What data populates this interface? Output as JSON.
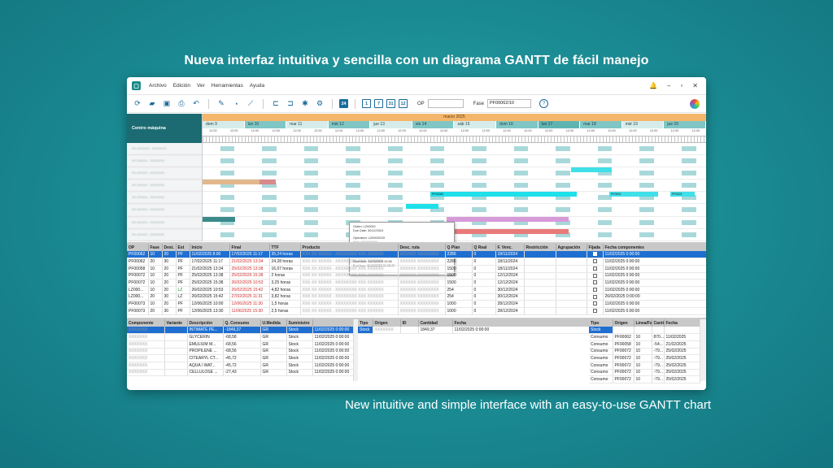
{
  "headline": "Nueva interfaz intuitiva y sencilla  con un diagrama GANTT de fácil manejo",
  "footline": "New intuitive and simple interface with an easy-to-use GANTT chart",
  "menu": [
    "Archivo",
    "Edición",
    "Ver",
    "Herramientas",
    "Ayuda"
  ],
  "toolbar": {
    "zoom_buttons": [
      "24",
      "1",
      "7",
      "31",
      "12"
    ],
    "op_label": "OP",
    "op_value": "",
    "fase_label": "Fase",
    "fase_value": "PF00062/10"
  },
  "gantt": {
    "side_header": "Centro máquina",
    "month": "marzo 2025",
    "days": [
      "dom 9",
      "lun 10",
      "mar 11",
      "mié 12",
      "jue 13",
      "vie 14",
      "sáb 15",
      "dom 16",
      "lun 17",
      "mar 18",
      "mié 19",
      "jue 20"
    ],
    "hour_label": "12:00",
    "popup": {
      "order": "Orden: LZ00020",
      "due": "Due Date: 30/12/2024",
      "op": "Operation: LZ00020/20",
      "qty": "Qty. Plan: 254",
      "datos": "Datos datos",
      "start": "Start time:   11/03/2025 12:08",
      "end": "End time:     11/03/2025 11:03:00"
    },
    "bar_labels": [
      "PF00062",
      "PF0003",
      "PF0003"
    ]
  },
  "main_table": {
    "columns": [
      "OP",
      "Fase",
      "Dest.",
      "Est",
      "Inicio",
      "Final",
      "TTF",
      "Producto",
      "Desc. ruta",
      "Q Plan",
      "Q Real",
      "F. Venc.",
      "Restricción",
      "Agrupación",
      "Fijada",
      "Fecha componentes"
    ],
    "rows": [
      {
        "op": "PF00062",
        "fase": "10",
        "dest": "20",
        "est": "PF",
        "inicio": "11/02/2025 8:00",
        "final": "17/02/2025 11:17",
        "ttf": "35,24 horas",
        "qplan": "2286",
        "qreal": "0",
        "fvenc": "18/11/2024",
        "fecha": "11/02/2025 0:00:00",
        "sel": true
      },
      {
        "op": "PF00062",
        "fase": "20",
        "dest": "30",
        "est": "PF",
        "inicio": "17/02/2025 11:17",
        "final": "21/02/2025 13:34",
        "ttf": "24,28 horas",
        "qplan": "2286",
        "qreal": "0",
        "fvenc": "18/11/2024",
        "fecha": "11/02/2025 0:00:00",
        "red": true
      },
      {
        "op": "PF00058",
        "fase": "10",
        "dest": "20",
        "est": "PF",
        "inicio": "21/02/2025 13:34",
        "final": "25/02/2025 13:38",
        "ttf": "16,07 horas",
        "qplan": "1500",
        "qreal": "0",
        "fvenc": "18/11/2024",
        "fecha": "11/02/2025 0:00:00",
        "red": true
      },
      {
        "op": "PF00072",
        "fase": "10",
        "dest": "20",
        "est": "PF",
        "inicio": "25/02/2025 13:38",
        "final": "25/02/2025 15:38",
        "ttf": "2 horas",
        "qplan": "1500",
        "qreal": "0",
        "fvenc": "12/12/2024",
        "fecha": "11/02/2025 0:00:00",
        "red": true
      },
      {
        "op": "PF00072",
        "fase": "10",
        "dest": "20",
        "est": "PF",
        "inicio": "25/02/2025 15:38",
        "final": "26/02/2025 10:53",
        "ttf": "3,25 horas",
        "qplan": "1500",
        "qreal": "0",
        "fvenc": "12/12/2024",
        "fecha": "11/02/2025 0:00:00",
        "red": true
      },
      {
        "op": "LZ000...",
        "fase": "10",
        "dest": "20",
        "est": "LZ",
        "inicio": "26/02/2025 10:53",
        "final": "26/02/2025 15:42",
        "ttf": "4,82 horas",
        "qplan": "254",
        "qreal": "0",
        "fvenc": "30/12/2024",
        "fecha": "11/02/2025 0:00:00",
        "red": true,
        "green": true
      },
      {
        "op": "LZ000...",
        "fase": "20",
        "dest": "30",
        "est": "LZ",
        "inicio": "26/02/2025 15:42",
        "final": "27/02/2025 11:31",
        "ttf": "3,82 horas",
        "qplan": "254",
        "qreal": "0",
        "fvenc": "30/12/2024",
        "fecha": "26/02/2025 0:00:00",
        "red": true
      },
      {
        "op": "PF00073",
        "fase": "10",
        "dest": "20",
        "est": "PF",
        "inicio": "12/06/2025 10:00",
        "final": "12/06/2025 11:30",
        "ttf": "1,5 horas",
        "qplan": "1000",
        "qreal": "0",
        "fvenc": "28/12/2024",
        "fecha": "11/02/2025 0:00:00",
        "red": true
      },
      {
        "op": "PF00073",
        "fase": "20",
        "dest": "30",
        "est": "PF",
        "inicio": "12/06/2025 13:30",
        "final": "11/06/2025 15:30",
        "ttf": "2,5 horas",
        "qplan": "1000",
        "qreal": "0",
        "fvenc": "28/12/2024",
        "fecha": "11/02/2025 0:00:00",
        "red": true
      }
    ]
  },
  "components_table": {
    "columns": [
      "Componente",
      "Variante",
      "Descripción",
      "Q. Consumo",
      "U.Medida",
      "Suministro",
      ""
    ],
    "rows": [
      {
        "desc": "INTIMATE PE...",
        "q": "-1849,37",
        "um": "GR",
        "sum": "Stock",
        "date": "11/02/2025 0:00:00",
        "sel": true
      },
      {
        "desc": "GLYCERIN",
        "q": "-68,58",
        "um": "GR",
        "sum": "Stock",
        "date": "11/02/2025 0:00:00"
      },
      {
        "desc": "EMULIUM M...",
        "q": "-68,56",
        "um": "GR",
        "sum": "Stock",
        "date": "11/02/2025 0:00:00"
      },
      {
        "desc": "PROPILENE ...",
        "q": "-68,56",
        "um": "GR",
        "sum": "Stock",
        "date": "11/02/2025 0:00:00"
      },
      {
        "desc": "CITEARYL CT...",
        "q": "-45,72",
        "um": "GR",
        "sum": "Stock",
        "date": "11/02/2025 0:00:00"
      },
      {
        "desc": "AQUA / WAT...",
        "q": "-45,72",
        "um": "GR",
        "sum": "Stock",
        "date": "11/02/2025 0:00:00"
      },
      {
        "desc": "CELLULOSE ...",
        "q": "-27,43",
        "um": "GR",
        "sum": "Stock",
        "date": "11/02/2025 0:00:00"
      }
    ]
  },
  "stock_table": {
    "columns": [
      "Tipo",
      "Origen",
      "ID",
      "Cantidad",
      "Fecha"
    ],
    "rows": [
      {
        "tipo": "Stock",
        "cantidad": "1849,37",
        "fecha": "11/02/2025 0:00:00",
        "sel": true
      }
    ]
  },
  "consumo_table": {
    "columns": [
      "Tipo",
      "Origen",
      "Línea/Fa",
      "Canti",
      "Fecha"
    ],
    "rows": [
      {
        "tipo": "Stock",
        "origen": "",
        "linea": "",
        "cant": "",
        "fecha": "",
        "sel": true
      },
      {
        "tipo": "Consumo",
        "origen": "PF00062",
        "linea": "10",
        "cant": "870...",
        "fecha": "11/02/2025"
      },
      {
        "tipo": "Consumo",
        "origen": "PF00058",
        "linea": "10",
        "cant": "-54...",
        "fecha": "21/02/2025"
      },
      {
        "tipo": "Consumo",
        "origen": "PF00072",
        "linea": "10",
        "cant": "-79...",
        "fecha": "25/02/2025"
      },
      {
        "tipo": "Consumo",
        "origen": "PF00072",
        "linea": "10",
        "cant": "-79...",
        "fecha": "25/02/2025"
      },
      {
        "tipo": "Consumo",
        "origen": "PF00072",
        "linea": "10",
        "cant": "-79...",
        "fecha": "25/02/2025"
      },
      {
        "tipo": "Consumo",
        "origen": "PF00072",
        "linea": "10",
        "cant": "-79...",
        "fecha": "25/02/2025"
      },
      {
        "tipo": "Consumo",
        "origen": "PF00072",
        "linea": "10",
        "cant": "-79...",
        "fecha": "25/02/2025"
      }
    ]
  },
  "colors": {
    "accent": "#1b6b9a",
    "teal": "#1c6b72",
    "month": "#f4b66a",
    "selection": "#1f6fd1"
  }
}
